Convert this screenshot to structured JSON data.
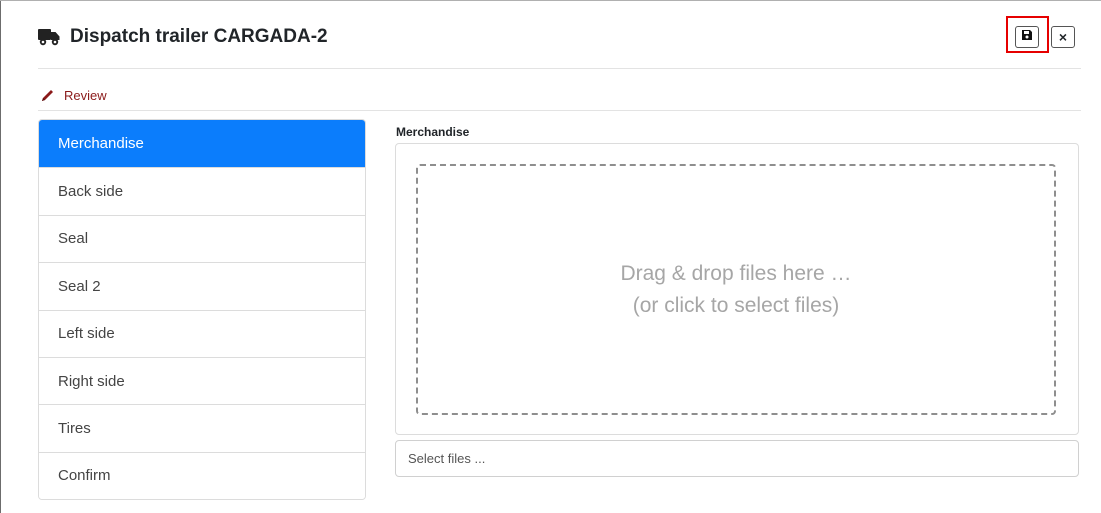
{
  "header": {
    "title": "Dispatch trailer CARGADA-2",
    "title_icon": "truck-icon",
    "save_icon": "floppy-disk-icon",
    "close_label": "×",
    "highlight_color": "#e60000"
  },
  "review": {
    "label": "Review",
    "icon": "pencil-icon",
    "color": "#8b1a1a"
  },
  "tabs": [
    {
      "label": "Merchandise",
      "active": true
    },
    {
      "label": "Back side"
    },
    {
      "label": "Seal"
    },
    {
      "label": "Seal 2"
    },
    {
      "label": "Left side"
    },
    {
      "label": "Right side"
    },
    {
      "label": "Tires"
    },
    {
      "label": "Confirm"
    }
  ],
  "accent_color": "#0b7dfc",
  "main": {
    "section_label": "Merchandise",
    "dropzone_line1": "Drag & drop files here …",
    "dropzone_line2": "(or click to select files)",
    "file_input_placeholder": "Select files ..."
  }
}
